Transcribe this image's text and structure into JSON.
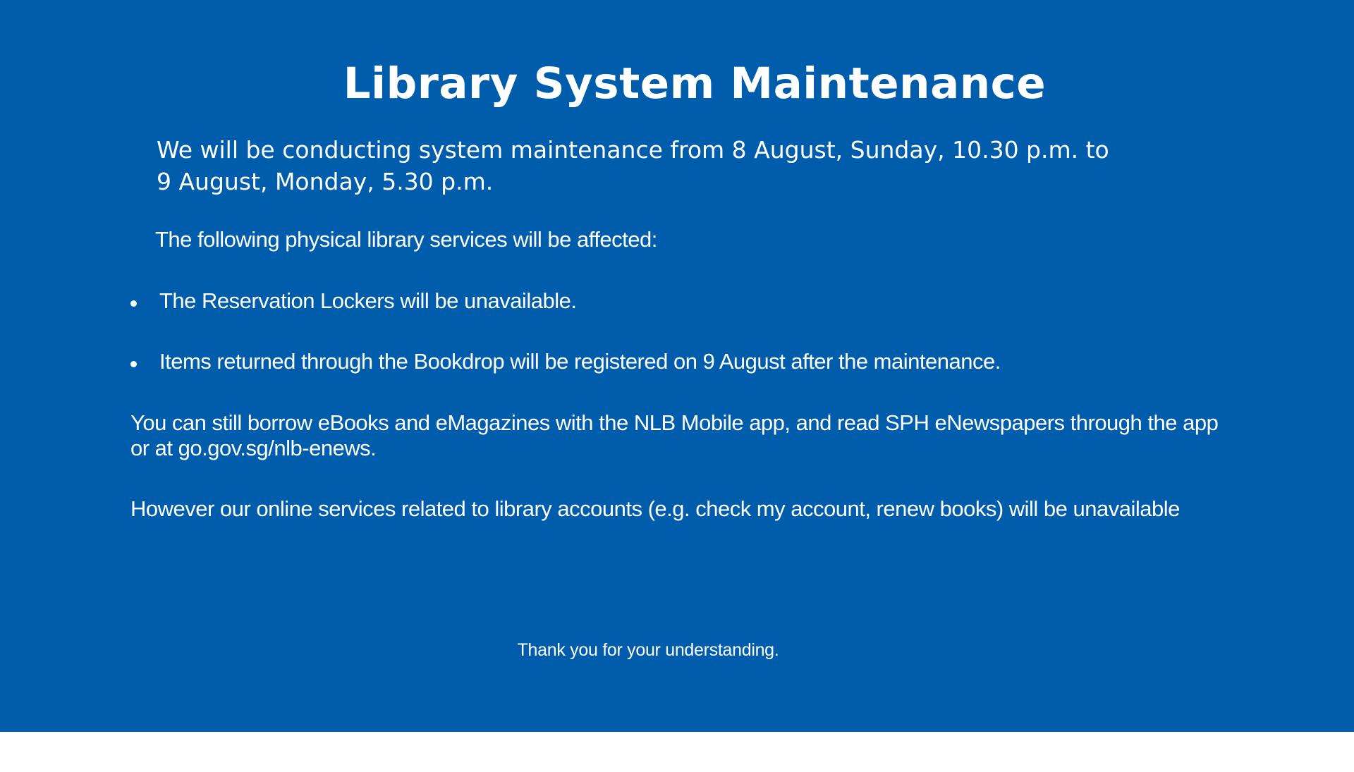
{
  "notice": {
    "title": "Library System Maintenance",
    "intro_line1": "We will be conducting system maintenance from 8 August, Sunday, 10.30 p.m. to",
    "intro_line2": "9 August, Monday, 5.30 p.m.",
    "affected_heading": "The following physical library services will be affected:",
    "bullets": [
      "The Reservation Lockers will be unavailable.",
      "Items returned through the Bookdrop will be registered on 9 August after the maintenance."
    ],
    "digital_services": "You can still borrow eBooks and eMagazines with the NLB Mobile app, and read SPH eNewspapers through the app or at go.gov.sg/nlb-enews.",
    "online_services": "However our online services related to library accounts (e.g. check my account, renew books) will be unavailable",
    "thanks": "Thank you for your understanding."
  },
  "colors": {
    "banner_background": "#005dac",
    "text": "#ffffff",
    "page_background": "#ffffff"
  }
}
